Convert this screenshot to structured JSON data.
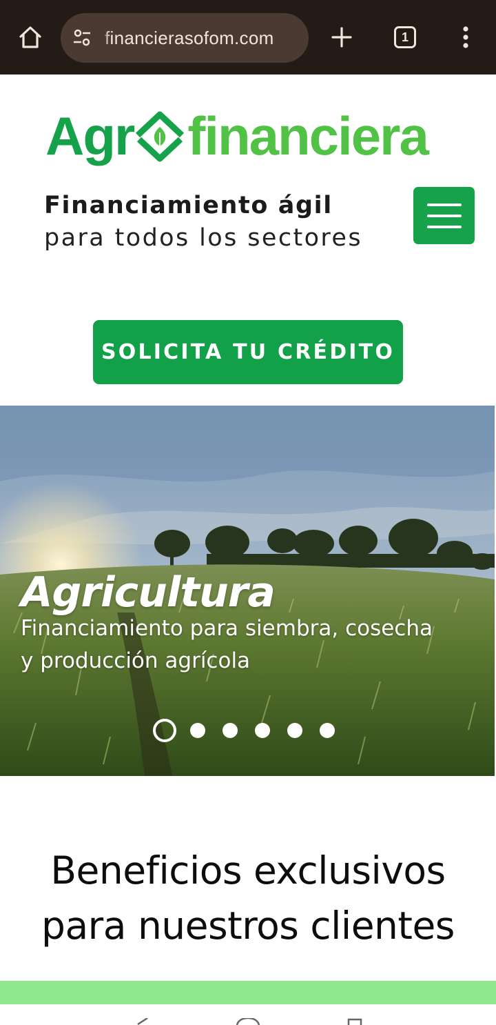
{
  "browser": {
    "url": "financierasofom.com",
    "tab_count": "1",
    "icons": [
      "home-icon",
      "site-info-icon",
      "plus-icon",
      "tabs-icon",
      "more-vert-icon"
    ]
  },
  "header": {
    "logo_left": "Agr",
    "logo_right": "financiera",
    "tagline_bold": "Financiamiento ágil",
    "tagline_light": "para todos los sectores",
    "menu_icon": "hamburger-icon"
  },
  "cta": {
    "label": "SOLICITA TU CRÉDITO"
  },
  "hero": {
    "title": "Agricultura",
    "subtitle": "Financiamiento para siembra, cosecha y producción agrícola",
    "slides_total": 6,
    "active_slide": 1
  },
  "benefits": {
    "title_line1": "Beneficios exclusivos",
    "title_line2": "para nuestros clientes"
  },
  "colors": {
    "brand_green": "#15a24a",
    "brand_light_green": "#52c247",
    "browser_bar": "#241b16",
    "strip": "#90e58f"
  }
}
